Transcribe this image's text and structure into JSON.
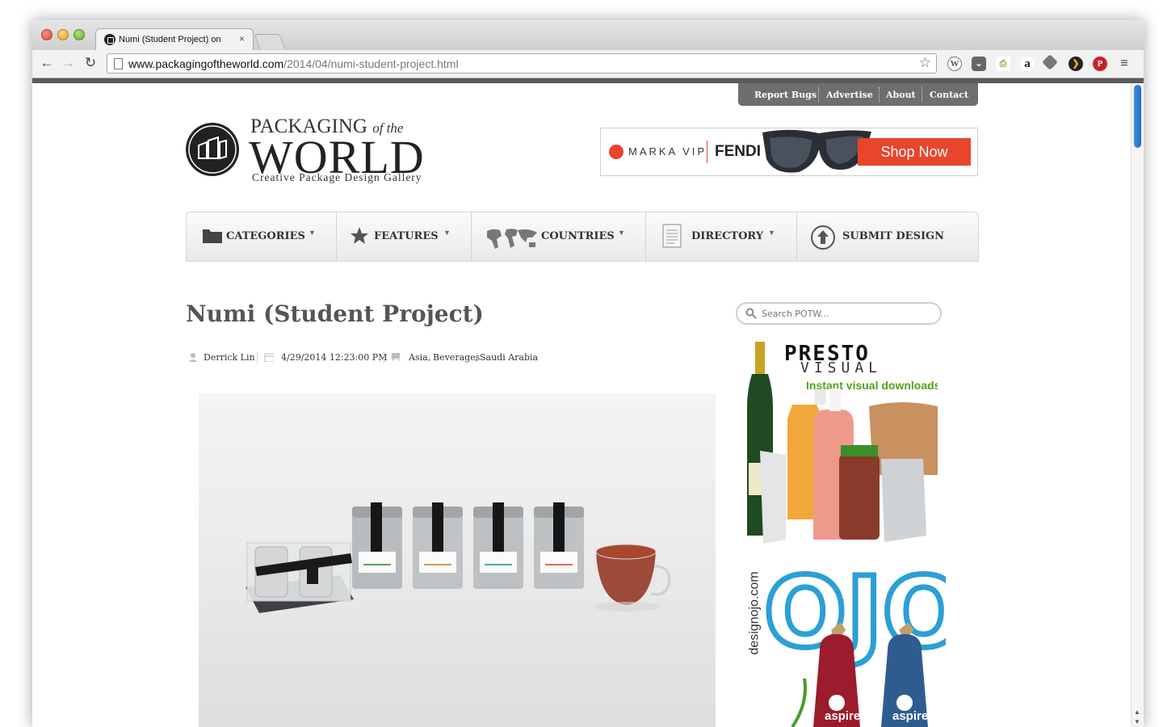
{
  "browser": {
    "tab_title": "Numi (Student Project) on",
    "tab_close": "×",
    "url_domain": "www.packagingoftheworld.com",
    "url_path": "/2014/04/numi-student-project.html",
    "extensions": [
      "wordpress-icon",
      "pocket-icon",
      "printer-icon",
      "amazon-icon",
      "feedly-icon",
      "plex-icon",
      "pinterest-icon",
      "menu-icon"
    ]
  },
  "topnav": {
    "links": [
      "Report Bugs",
      "Advertise",
      "About",
      "Contact"
    ]
  },
  "logo": {
    "line1": "PACKAGING",
    "line1_italic": "of the",
    "line2": "WORLD",
    "line3": "Creative Package Design Gallery"
  },
  "banner": {
    "brand": "MARKA VIP",
    "partner": "FENDI",
    "cta": "Shop Now",
    "accent": "#e8452c"
  },
  "mainnav": {
    "items": [
      {
        "label": "CATEGORIES",
        "icon": "folder-icon",
        "has_caret": true
      },
      {
        "label": "FEATURES",
        "icon": "star-icon",
        "has_caret": true
      },
      {
        "label": "COUNTRIES",
        "icon": "world-map-icon",
        "has_caret": true
      },
      {
        "label": "DIRECTORY",
        "icon": "document-icon",
        "has_caret": true
      },
      {
        "label": "SUBMIT DESIGN",
        "icon": "upload-arrow-icon",
        "has_caret": false
      }
    ]
  },
  "post": {
    "title": "Numi (Student Project)",
    "author": "Derrick Lin",
    "date": "4/29/2014 12:23:00 PM",
    "tags": [
      "Asia",
      "Beverages",
      "Saudi Arabia"
    ],
    "tag_sep": ","
  },
  "sidebar": {
    "search_placeholder": "Search POTW...",
    "ad1": {
      "title": "PRESTO",
      "subtitle": "VISUAL",
      "tagline": "Instant visual downloads"
    },
    "ad2": {
      "site": "designojo.com",
      "brand": "OJO",
      "product": "aspire"
    }
  }
}
